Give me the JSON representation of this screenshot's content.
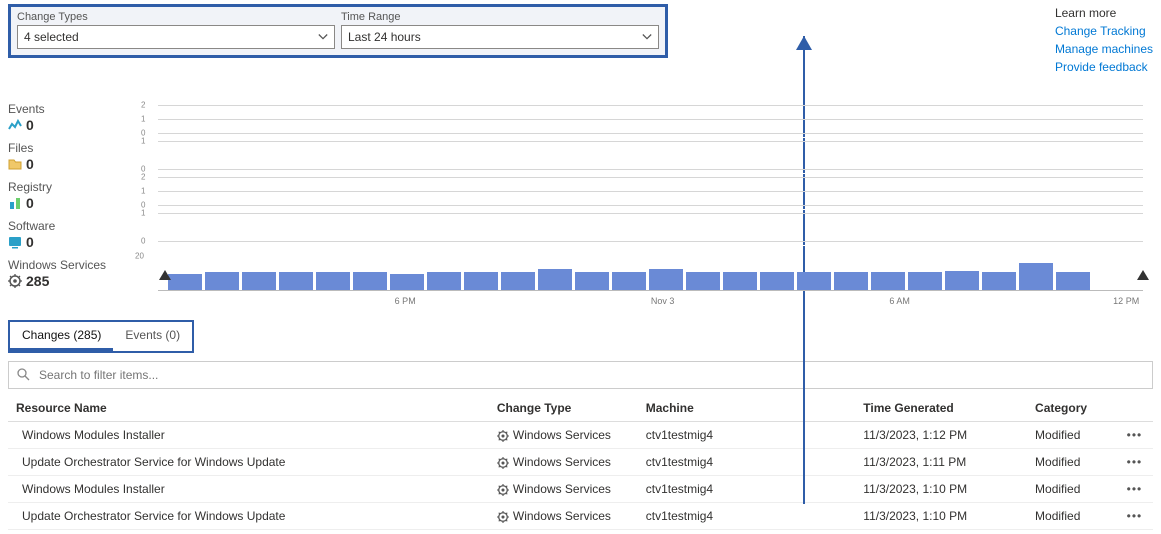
{
  "filters": {
    "change_types_label": "Change Types",
    "change_types_value": "4 selected",
    "time_range_label": "Time Range",
    "time_range_value": "Last 24 hours"
  },
  "learn": {
    "header": "Learn more",
    "links": [
      "Change Tracking",
      "Manage machines",
      "Provide feedback"
    ]
  },
  "stats": {
    "events": {
      "label": "Events",
      "value": "0"
    },
    "files": {
      "label": "Files",
      "value": "0"
    },
    "registry": {
      "label": "Registry",
      "value": "0"
    },
    "software": {
      "label": "Software",
      "value": "0"
    },
    "services": {
      "label": "Windows Services",
      "value": "285"
    }
  },
  "chart_data": [
    {
      "type": "bar",
      "name": "Events",
      "ylabels": [
        "0",
        "1",
        "2"
      ],
      "values": []
    },
    {
      "type": "bar",
      "name": "Files",
      "ylabels": [
        "0",
        "1"
      ],
      "values": []
    },
    {
      "type": "bar",
      "name": "Registry",
      "ylabels": [
        "0",
        "1",
        "2"
      ],
      "values": []
    },
    {
      "type": "bar",
      "name": "Software",
      "ylabels": [
        "0",
        "1"
      ],
      "values": []
    },
    {
      "type": "bar",
      "name": "Windows Services",
      "ylabels": [
        "20"
      ],
      "xticks": [
        "6 PM",
        "Nov 3",
        "6 AM",
        "12 PM"
      ],
      "values": [
        11,
        12,
        12,
        12,
        12,
        12,
        11,
        12,
        12,
        12,
        14,
        12,
        12,
        14,
        12,
        12,
        12,
        12,
        12,
        12,
        12,
        13,
        12,
        18,
        12
      ]
    }
  ],
  "tabs": {
    "changes": "Changes (285)",
    "events": "Events (0)"
  },
  "search": {
    "placeholder": "Search to filter items..."
  },
  "table": {
    "headers": {
      "resource": "Resource Name",
      "change_type": "Change Type",
      "machine": "Machine",
      "time": "Time Generated",
      "category": "Category"
    },
    "change_type_value": "Windows Services",
    "rows": [
      {
        "resource": "Windows Modules Installer",
        "machine": "ctv1testmig4",
        "time": "11/3/2023, 1:12 PM",
        "category": "Modified"
      },
      {
        "resource": "Update Orchestrator Service for Windows Update",
        "machine": "ctv1testmig4",
        "time": "11/3/2023, 1:11 PM",
        "category": "Modified"
      },
      {
        "resource": "Windows Modules Installer",
        "machine": "ctv1testmig4",
        "time": "11/3/2023, 1:10 PM",
        "category": "Modified"
      },
      {
        "resource": "Update Orchestrator Service for Windows Update",
        "machine": "ctv1testmig4",
        "time": "11/3/2023, 1:10 PM",
        "category": "Modified"
      }
    ]
  },
  "colors": {
    "accent": "#2f5da8",
    "link": "#0078d4",
    "bar": "#6a8ad6"
  }
}
